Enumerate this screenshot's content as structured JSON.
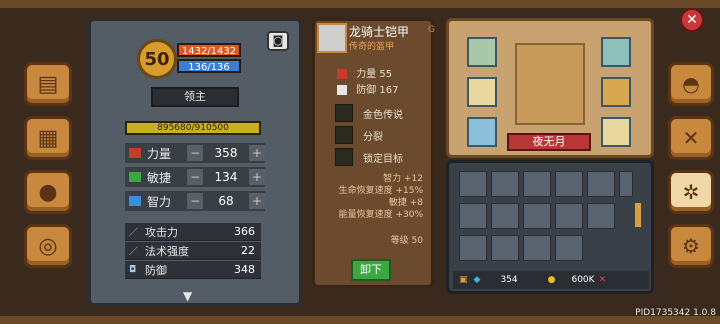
{
  "hero": {
    "level": "50",
    "hp": "1432/1432",
    "mp": "136/136",
    "title": "领主",
    "exp": "895680/910500"
  },
  "attributes": [
    {
      "label": "力量",
      "value": "358",
      "color": "#c83a2a"
    },
    {
      "label": "敏捷",
      "value": "134",
      "color": "#3ca640"
    },
    {
      "label": "智力",
      "value": "68",
      "color": "#3c8ed6"
    }
  ],
  "derived": [
    {
      "label": "攻击力",
      "value": "366"
    },
    {
      "label": "法术强度",
      "value": "22"
    },
    {
      "label": "防御",
      "value": "348"
    }
  ],
  "item": {
    "name": "龙骑士铠甲",
    "subtitle": "传奇的盔甲",
    "tag": "G",
    "stats": [
      {
        "label": "力量",
        "value": "55",
        "color": "#c83a2a"
      },
      {
        "label": "防御",
        "value": "167",
        "color": "#e6e6e6"
      }
    ],
    "perks": [
      {
        "label": "金色传说",
        "color": "#e8c020"
      },
      {
        "label": "分裂",
        "color": "#3ca640"
      },
      {
        "label": "锁定目标",
        "color": "#3ca640"
      }
    ],
    "bonuses": [
      "智力 +12",
      "生命恢复速度 +15%",
      "敏捷 +8",
      "能量恢复速度 +30%"
    ],
    "level_req": "等级 50",
    "unequip_label": "卸下"
  },
  "equipment": {
    "character_name": "夜无月",
    "slot_icons": [
      "ring-icon",
      "armor-icon",
      "ring-icon",
      "chestplate-icon",
      "boots-icon",
      "sword-icon"
    ]
  },
  "inventory": {
    "gems": "354",
    "gold": "600K",
    "cells": 21
  },
  "right_nav_icons": [
    "helmet-icon",
    "crossed-swords-icon",
    "compass-icon",
    "gear-icon"
  ],
  "left_nav_icons": [
    "book-icon",
    "map-icon",
    "pet-icon",
    "wheel-icon"
  ],
  "version": "PID1735342 1.0.8"
}
